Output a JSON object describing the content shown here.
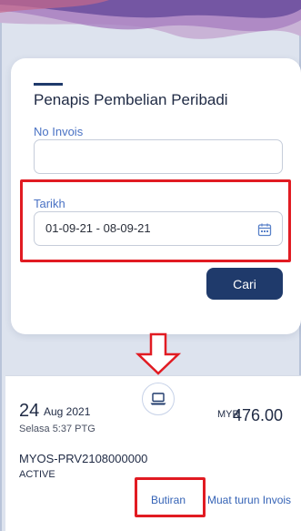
{
  "filter": {
    "title": "Penapis Pembelian Peribadi",
    "invoice_label": "No Invois",
    "invoice_value": "",
    "date_label": "Tarikh",
    "date_value": "01-09-21 - 08-09-21",
    "search_label": "Cari"
  },
  "result": {
    "day": "24",
    "month_year": "Aug 2021",
    "time": "Selasa 5:37 PTG",
    "currency": "MYR",
    "amount": "476.00",
    "invoice_no": "MYOS-PRV2108000000",
    "status": "ACTIVE",
    "details_link": "Butiran",
    "download_link": "Muat turun Invois"
  },
  "icons": {
    "calendar": "calendar-icon",
    "laptop": "laptop-icon",
    "arrow": "down-arrow-icon"
  },
  "colors": {
    "primary": "#1f3a6b",
    "link": "#3563b6",
    "label": "#4a72c4",
    "highlight": "#e11b22"
  }
}
